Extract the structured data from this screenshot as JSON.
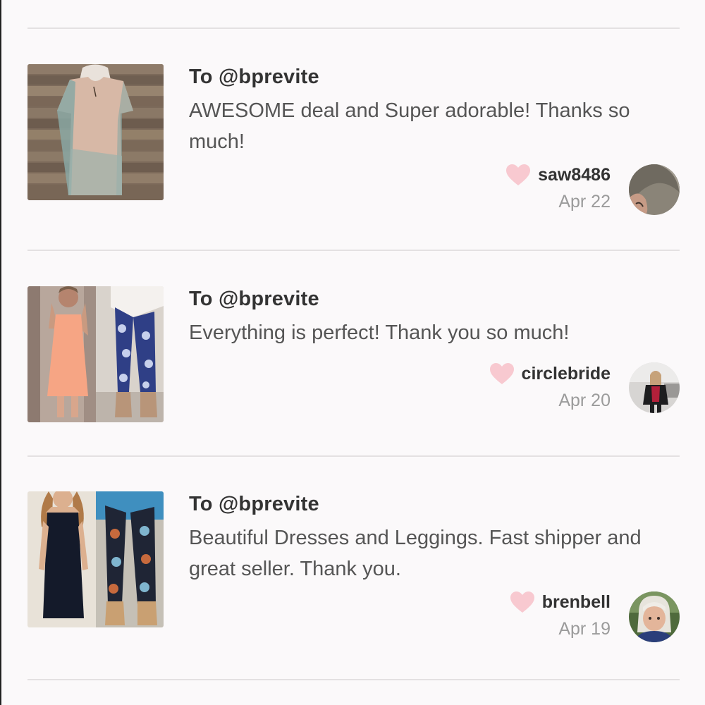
{
  "reviews": [
    {
      "to_prefix": "To",
      "to_user": "@bprevite",
      "comment": "AWESOME deal and Super adorable! Thanks so much!",
      "username": "saw8486",
      "date": "Apr 22"
    },
    {
      "to_prefix": "To",
      "to_user": "@bprevite",
      "comment": "Everything is perfect! Thank you so much!",
      "username": "circlebride",
      "date": "Apr 20"
    },
    {
      "to_prefix": "To",
      "to_user": "@bprevite",
      "comment": "Beautiful Dresses and Leggings. Fast shipper and great seller. Thank you.",
      "username": "brenbell",
      "date": "Apr 19"
    }
  ],
  "colors": {
    "heart": "#f8c9d0",
    "divider": "#e4e1e2",
    "background": "#fbf9fa",
    "date_text": "#9b9b9b"
  },
  "icons": {
    "like": "heart-icon"
  }
}
